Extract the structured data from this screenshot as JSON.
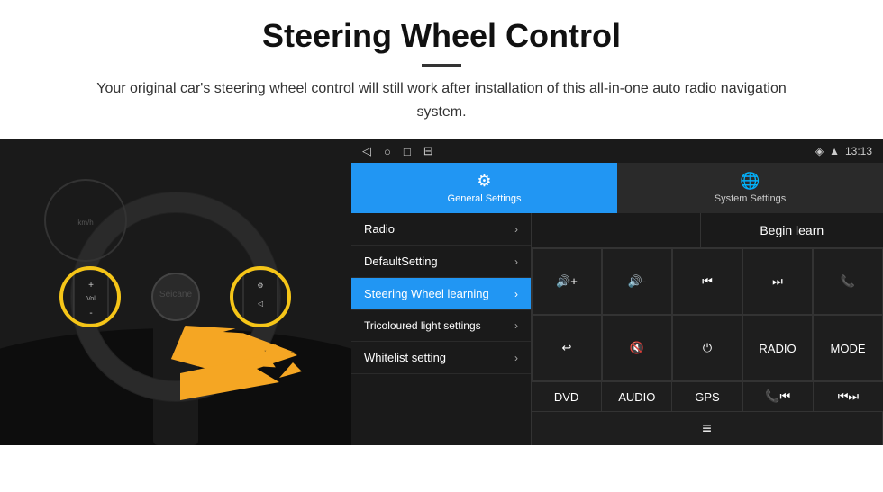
{
  "header": {
    "title": "Steering Wheel Control",
    "subtitle": "Your original car's steering wheel control will still work after installation of this all-in-one auto radio navigation system."
  },
  "android_ui": {
    "status_bar": {
      "time": "13:13",
      "icons": [
        "◁",
        "○",
        "□",
        "⊟"
      ]
    },
    "tabs": [
      {
        "label": "General Settings",
        "icon": "⚙",
        "active": true
      },
      {
        "label": "System Settings",
        "icon": "🌐",
        "active": false
      }
    ],
    "menu_items": [
      {
        "label": "Radio",
        "active": false
      },
      {
        "label": "DefaultSetting",
        "active": false
      },
      {
        "label": "Steering Wheel learning",
        "active": true
      },
      {
        "label": "Tricoloured light settings",
        "active": false
      },
      {
        "label": "Whitelist setting",
        "active": false
      }
    ],
    "begin_learn_label": "Begin learn",
    "control_buttons_row1": [
      "🔊+",
      "🔊-",
      "⏮",
      "⏭",
      "📞"
    ],
    "control_buttons_row2": [
      "↩",
      "🔇",
      "⏻",
      "RADIO",
      "MODE"
    ],
    "bottom_buttons": [
      "DVD",
      "AUDIO",
      "GPS",
      "📞⏮",
      "⏮⏭"
    ],
    "last_row_icon": "≡"
  }
}
